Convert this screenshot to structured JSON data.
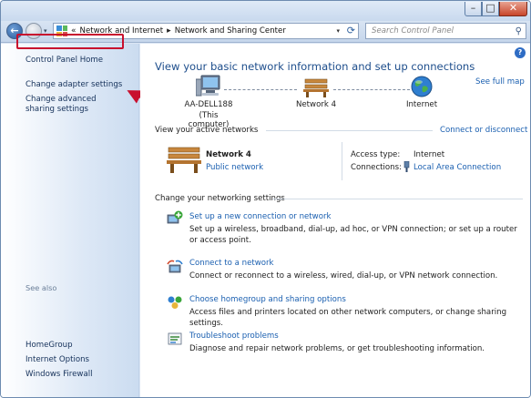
{
  "window": {
    "controls": {
      "minimize": "–",
      "maximize": "□",
      "close": "✕"
    }
  },
  "address_bar": {
    "recent_arrow": "▾",
    "separator": "«",
    "crumbs": [
      "Network and Internet",
      "Network and Sharing Center"
    ],
    "crumb_arrow": "▸",
    "dropdown": "▾",
    "refresh": "⟳"
  },
  "search": {
    "placeholder": "Search Control Panel"
  },
  "sidebar": {
    "home": "Control Panel Home",
    "links": [
      "Change adapter settings",
      "Change advanced sharing settings"
    ],
    "see_also_title": "See also",
    "see_also": [
      "HomeGroup",
      "Internet Options",
      "Windows Firewall"
    ]
  },
  "main": {
    "help": "?",
    "title": "View your basic network information and set up connections",
    "see_full_map": "See full map",
    "map": {
      "computer_name": "AA-DELL188",
      "computer_sub": "(This computer)",
      "network_name": "Network  4",
      "internet": "Internet"
    },
    "active_networks": {
      "title": "View your active networks",
      "connect_link": "Connect or disconnect",
      "network_name": "Network  4",
      "network_type": "Public network",
      "access_type_label": "Access type:",
      "access_type_value": "Internet",
      "connections_label": "Connections:",
      "connections_value": "Local Area Connection"
    },
    "settings": {
      "title": "Change your networking settings",
      "tasks": [
        {
          "link": "Set up a new connection or network",
          "desc": "Set up a wireless, broadband, dial-up, ad hoc, or VPN connection; or set up a router or access point."
        },
        {
          "link": "Connect to a network",
          "desc": "Connect or reconnect to a wireless, wired, dial-up, or VPN network connection."
        },
        {
          "link": "Choose homegroup and sharing options",
          "desc": "Access files and printers located on other network computers, or change sharing settings."
        },
        {
          "link": "Troubleshoot problems",
          "desc": "Diagnose and repair network problems, or get troubleshooting information."
        }
      ]
    }
  },
  "colors": {
    "accent": "#1a5fb0",
    "highlight": "#c8102e",
    "title": "#1e4e8c"
  }
}
